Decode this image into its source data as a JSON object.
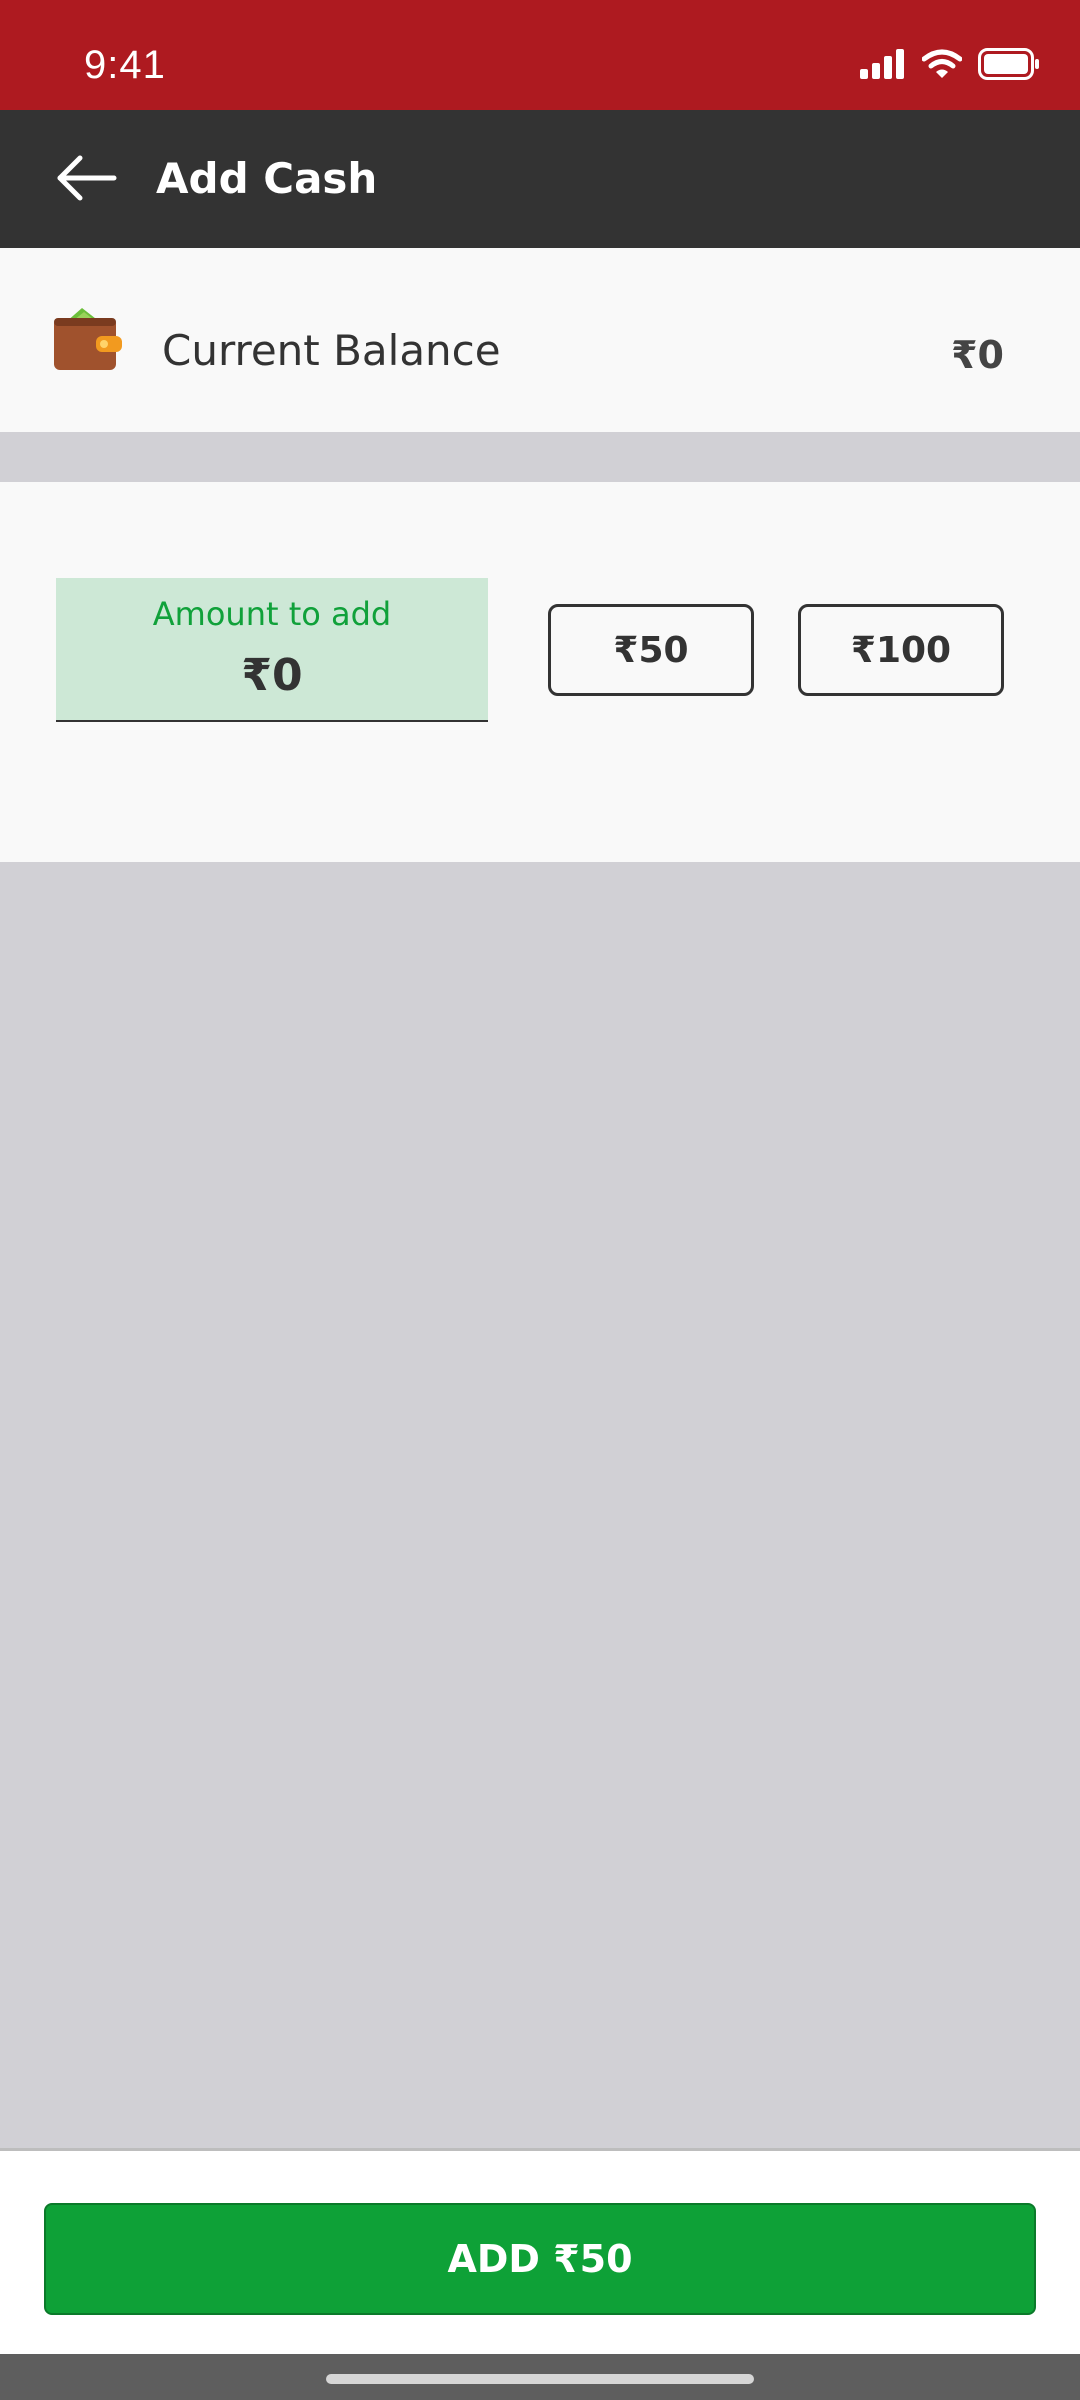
{
  "status_bar": {
    "time": "9:41",
    "icons": [
      "cellular-signal-icon",
      "wifi-icon",
      "battery-icon"
    ],
    "background": "#ae1a20"
  },
  "app_bar": {
    "title": "Add Cash",
    "back_icon": "back-arrow-icon",
    "background": "#333333"
  },
  "balance": {
    "label": "Current Balance",
    "value": "₹0",
    "icon": "wallet-icon"
  },
  "amount_input": {
    "label": "Amount to add",
    "value": "₹0",
    "label_color": "#10a13a",
    "background": "#cde8d6"
  },
  "quick_amounts": [
    "₹50",
    "₹100"
  ],
  "primary_action": {
    "label": "ADD ₹50",
    "background": "#0ea137"
  }
}
